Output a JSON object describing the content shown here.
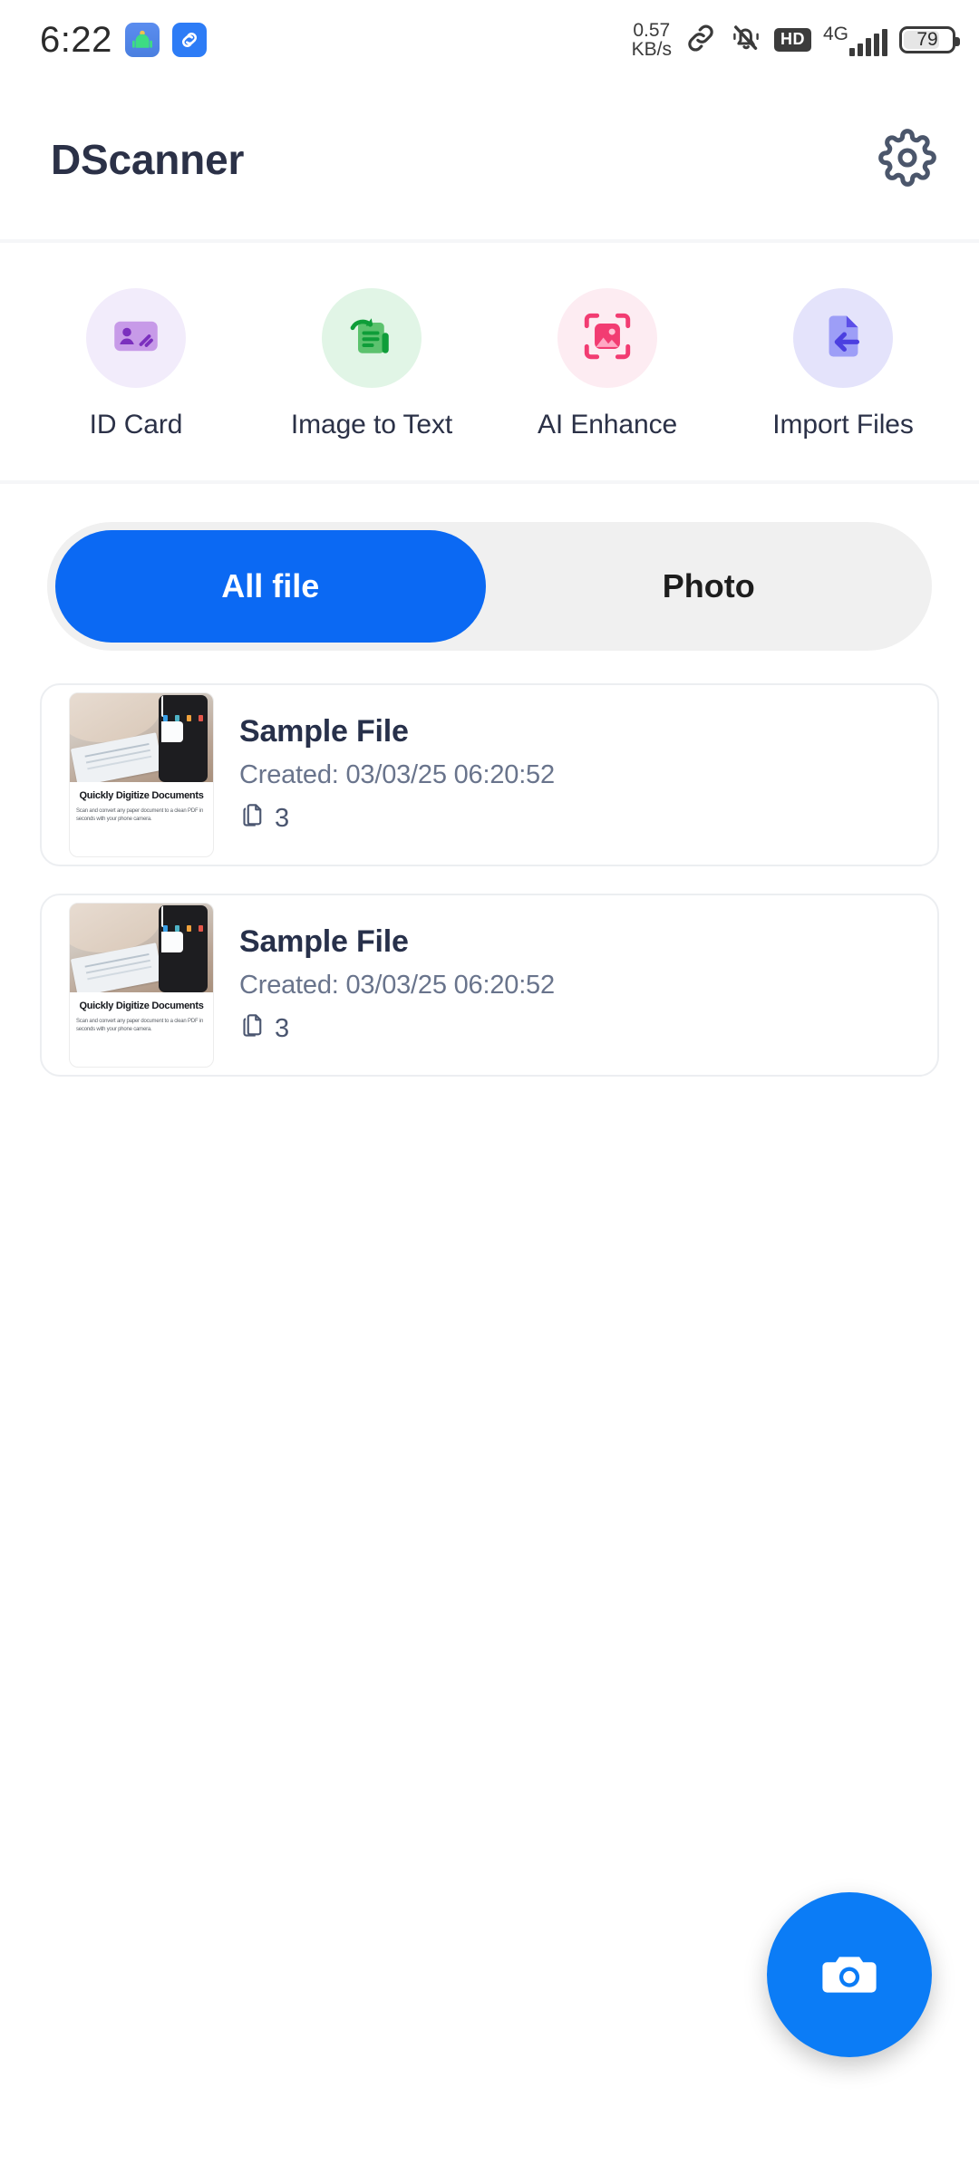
{
  "statusbar": {
    "clock": "6:22",
    "left_icons": [
      {
        "name": "android-bot-app-icon"
      },
      {
        "name": "link-app-icon"
      }
    ],
    "network_speed_value": "0.57",
    "network_speed_unit": "KB/s",
    "icons": [
      {
        "name": "link-icon"
      },
      {
        "name": "bell-muted-icon"
      }
    ],
    "hd_badge": "HD",
    "network_type": "4G",
    "signal_bars": 5,
    "battery_percent": "79"
  },
  "appbar": {
    "title": "DScanner",
    "settings_icon": "gear-icon"
  },
  "quick_actions": [
    {
      "label": "ID Card",
      "icon": "id-card-icon",
      "bubble_color": "#f2ecfb",
      "icon_color": "#b07fe0"
    },
    {
      "label": "Image to Text",
      "icon": "image-to-text-icon",
      "bubble_color": "#e1f5e6",
      "icon_color": "#39b54a"
    },
    {
      "label": "AI Enhance",
      "icon": "ai-enhance-icon",
      "bubble_color": "#fdecf2",
      "icon_color": "#f23c72"
    },
    {
      "label": "Import Files",
      "icon": "import-files-icon",
      "bubble_color": "#e4e3fb",
      "icon_color": "#8a8bf5"
    }
  ],
  "tabs": {
    "active_index": 0,
    "items": [
      {
        "label": "All file"
      },
      {
        "label": "Photo"
      }
    ],
    "active_color": "#0b69f3",
    "track_color": "#f0f0f0"
  },
  "files": [
    {
      "name": "Sample File",
      "created": "Created: 03/03/25 06:20:52",
      "pages": "3",
      "pages_icon": "pages-icon",
      "thumbnail": {
        "heading": "Quickly Digitize Documents",
        "body": "Scan and convert any paper document to a clean PDF in seconds with your phone camera."
      }
    },
    {
      "name": "Sample File",
      "created": "Created: 03/03/25 06:20:52",
      "pages": "3",
      "pages_icon": "pages-icon",
      "thumbnail": {
        "heading": "Quickly Digitize Documents",
        "body": "Scan and convert any paper document to a clean PDF in seconds with your phone camera."
      }
    }
  ],
  "fab": {
    "icon": "camera-icon",
    "color": "#0b7cf6"
  }
}
